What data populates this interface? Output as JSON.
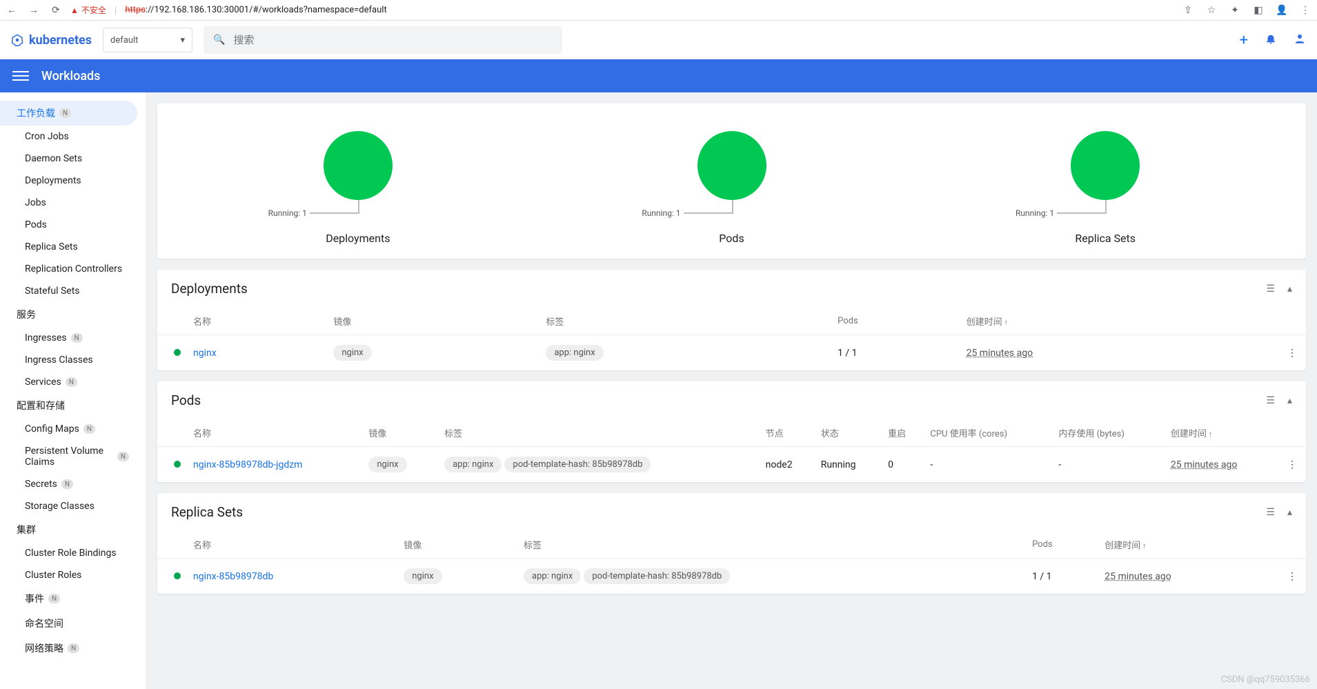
{
  "browser": {
    "insecure": "不安全",
    "url_proto": "https",
    "url_rest": "://192.168.186.130:30001/#/workloads?namespace=default"
  },
  "brand": "kubernetes",
  "namespace": "default",
  "search": {
    "placeholder": "搜索"
  },
  "bluebar": {
    "title": "Workloads"
  },
  "sidebar": {
    "workloads": "工作负载",
    "items1": [
      "Cron Jobs",
      "Daemon Sets",
      "Deployments",
      "Jobs",
      "Pods",
      "Replica Sets",
      "Replication Controllers",
      "Stateful Sets"
    ],
    "service_hdr": "服务",
    "items2": [
      {
        "l": "Ingresses",
        "n": true
      },
      {
        "l": "Ingress Classes"
      },
      {
        "l": "Services",
        "n": true
      }
    ],
    "config_hdr": "配置和存储",
    "items3": [
      {
        "l": "Config Maps",
        "n": true
      },
      {
        "l": "Persistent Volume Claims",
        "n": true
      },
      {
        "l": "Secrets",
        "n": true
      },
      {
        "l": "Storage Classes"
      }
    ],
    "cluster_hdr": "集群",
    "items4": [
      {
        "l": "Cluster Role Bindings"
      },
      {
        "l": "Cluster Roles"
      },
      {
        "l": "事件",
        "n": true
      },
      {
        "l": "命名空间"
      },
      {
        "l": "网络策略",
        "n": true
      }
    ]
  },
  "chart_data": [
    {
      "type": "pie",
      "title": "Deployments",
      "series": [
        {
          "name": "Running",
          "value": 1
        }
      ],
      "label": "Running: 1"
    },
    {
      "type": "pie",
      "title": "Pods",
      "series": [
        {
          "name": "Running",
          "value": 1
        }
      ],
      "label": "Running: 1"
    },
    {
      "type": "pie",
      "title": "Replica Sets",
      "series": [
        {
          "name": "Running",
          "value": 1
        }
      ],
      "label": "Running: 1"
    }
  ],
  "deploy": {
    "title": "Deployments",
    "cols": {
      "name": "名称",
      "image": "镜像",
      "labels": "标签",
      "pods": "Pods",
      "created": "创建时间"
    },
    "rows": [
      {
        "name": "nginx",
        "image": "nginx",
        "labels": [
          "app: nginx"
        ],
        "pods": "1 / 1",
        "created": "25 minutes ago"
      }
    ]
  },
  "pods": {
    "title": "Pods",
    "cols": {
      "name": "名称",
      "image": "镜像",
      "labels": "标签",
      "node": "节点",
      "status": "状态",
      "restarts": "重启",
      "cpu": "CPU 使用率 (cores)",
      "mem": "内存使用 (bytes)",
      "created": "创建时间"
    },
    "rows": [
      {
        "name": "nginx-85b98978db-jgdzm",
        "image": "nginx",
        "labels": [
          "app: nginx",
          "pod-template-hash: 85b98978db"
        ],
        "node": "node2",
        "status": "Running",
        "restarts": "0",
        "cpu": "-",
        "mem": "-",
        "created": "25 minutes ago"
      }
    ]
  },
  "rs": {
    "title": "Replica Sets",
    "cols": {
      "name": "名称",
      "image": "镜像",
      "labels": "标签",
      "pods": "Pods",
      "created": "创建时间"
    },
    "rows": [
      {
        "name": "nginx-85b98978db",
        "image": "nginx",
        "labels": [
          "app: nginx",
          "pod-template-hash: 85b98978db"
        ],
        "pods": "1 / 1",
        "created": "25 minutes ago"
      }
    ]
  },
  "watermark": "CSDN @qq759035366"
}
